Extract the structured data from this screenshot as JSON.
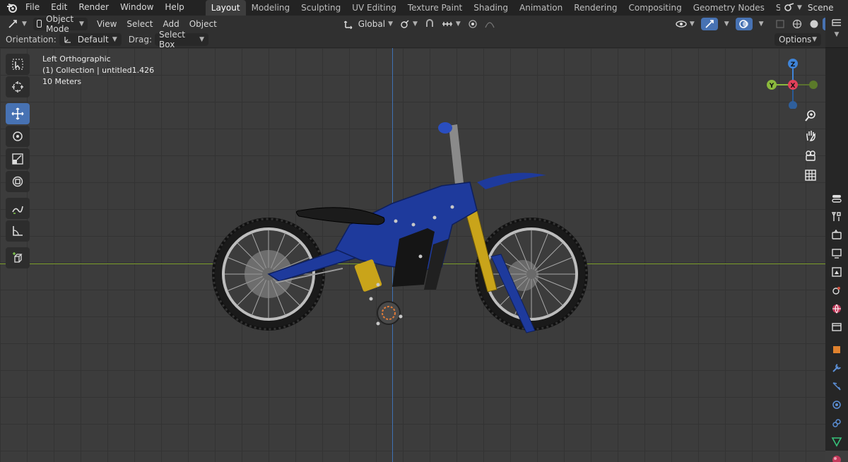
{
  "topbar": {
    "menus": [
      "File",
      "Edit",
      "Render",
      "Window",
      "Help"
    ],
    "workspace_tabs": [
      "Layout",
      "Modeling",
      "Sculpting",
      "UV Editing",
      "Texture Paint",
      "Shading",
      "Animation",
      "Rendering",
      "Compositing",
      "Geometry Nodes",
      "Scripting"
    ],
    "active_tab": "Layout",
    "scene_label": "Scene"
  },
  "viewport_header": {
    "mode": "Object Mode",
    "menus": [
      "View",
      "Select",
      "Add",
      "Object"
    ],
    "transform_orientation": "Global"
  },
  "tool_header": {
    "orientation_label": "Orientation:",
    "orientation_value": "Default",
    "drag_label": "Drag:",
    "drag_value": "Select Box",
    "options_label": "Options"
  },
  "viewport": {
    "view_name": "Left Orthographic",
    "collection_info": "(1) Collection | untitled1.426",
    "scale_info": "10 Meters"
  },
  "gizmo": {
    "axis_z": "Z",
    "axis_y": "Y",
    "axis_x": "X"
  },
  "colors": {
    "accent": "#4772b3",
    "axis_x": "#e2405a",
    "axis_y": "#8bb93d",
    "axis_z": "#3f84d8",
    "bike_body": "#1e3a9c"
  },
  "toolbar_icons": [
    "select-box-icon",
    "cursor-icon",
    "move-icon",
    "rotate-icon",
    "scale-icon",
    "transform-icon",
    "annotate-icon",
    "measure-icon",
    "add-cube-icon"
  ],
  "properties_icons": [
    "tool-icon",
    "render-icon",
    "output-icon",
    "view-layer-icon",
    "scene-icon",
    "world-icon",
    "collection-icon",
    "object-icon",
    "modifier-icon",
    "particles-icon",
    "physics-icon",
    "constraints-icon",
    "data-icon",
    "material-icon"
  ]
}
